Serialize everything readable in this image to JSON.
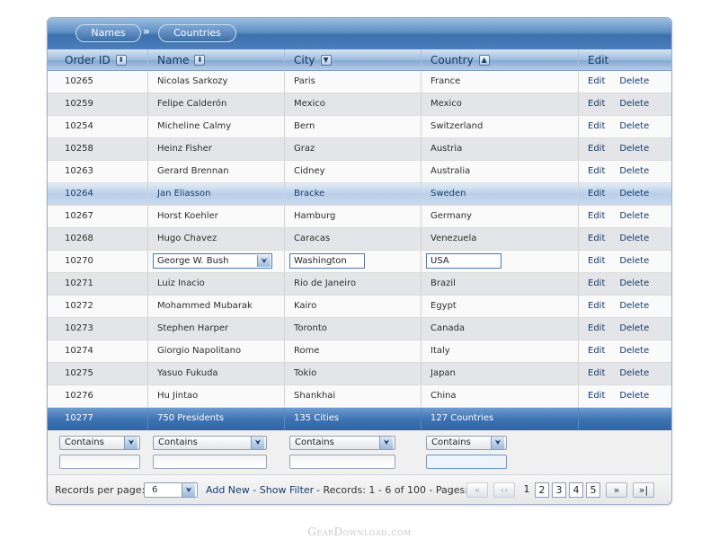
{
  "breadcrumb": {
    "items": [
      "Names",
      "Countries"
    ],
    "separator": "»"
  },
  "columns": [
    {
      "label": "Order ID",
      "sort": "both"
    },
    {
      "label": "Name",
      "sort": "both"
    },
    {
      "label": "City",
      "sort": "desc"
    },
    {
      "label": "Country",
      "sort": "asc"
    },
    {
      "label": "Edit",
      "sort": "none"
    }
  ],
  "rows": [
    {
      "id": "10265",
      "name": "Nicolas Sarkozy",
      "city": "Paris",
      "country": "France"
    },
    {
      "id": "10259",
      "name": "Felipe Calderón",
      "city": "Mexico",
      "country": "Mexico"
    },
    {
      "id": "10254",
      "name": "Micheline Calmy",
      "city": "Bern",
      "country": "Switzerland"
    },
    {
      "id": "10258",
      "name": "Heinz Fisher",
      "city": "Graz",
      "country": "Austria"
    },
    {
      "id": "10263",
      "name": "Gerard Brennan",
      "city": "Cidney",
      "country": "Australia"
    },
    {
      "id": "10264",
      "name": "Jan Eliasson",
      "city": "Bracke",
      "country": "Sweden"
    },
    {
      "id": "10267",
      "name": "Horst Koehler",
      "city": "Hamburg",
      "country": "Germany"
    },
    {
      "id": "10268",
      "name": "Hugo Chavez",
      "city": "Caracas",
      "country": "Venezuela"
    },
    {
      "id": "10270",
      "name": "George W. Bush",
      "city": "Washington",
      "country": "USA"
    },
    {
      "id": "10271",
      "name": "Luiz Inacio",
      "city": "Rio de Janeiro",
      "country": "Brazil"
    },
    {
      "id": "10272",
      "name": "Mohammed Mubarak",
      "city": "Kairo",
      "country": "Egypt"
    },
    {
      "id": "10273",
      "name": "Stephen Harper",
      "city": "Toronto",
      "country": "Canada"
    },
    {
      "id": "10274",
      "name": "Giorgio Napolitano",
      "city": "Rome",
      "country": "Italy"
    },
    {
      "id": "10275",
      "name": "Yasuo Fukuda",
      "city": "Tokio",
      "country": "Japan"
    },
    {
      "id": "10276",
      "name": "Hu Jintao",
      "city": "Shankhai",
      "country": "China"
    }
  ],
  "row_actions": {
    "edit": "Edit",
    "delete": "Delete"
  },
  "selected_row_index": 5,
  "editing_row_index": 8,
  "footer": {
    "id": "10277",
    "name": "750 Presidents",
    "city": "135 Cities",
    "country": "127 Countries"
  },
  "filters": {
    "condition": "Contains",
    "values": [
      "",
      "",
      "",
      ""
    ]
  },
  "pager": {
    "records_per_page_label": "Records per page:",
    "records_per_page_value": "6",
    "add_new": "Add New",
    "separator": " - ",
    "show_filter": "Show Filter",
    "records_text": "- Records: 1 - 6 of 100 - Pages:",
    "first": "«",
    "prev": "‹‹",
    "pages": [
      "1",
      "2",
      "3",
      "4",
      "5"
    ],
    "current_page": "1",
    "next": "»",
    "last": "»|"
  },
  "watermark": "GearDownload.com",
  "colors": {
    "accent": "#3b6fae",
    "header_light": "#c4d7ec",
    "row_alt": "#e4e5e8",
    "link": "#163a6c"
  }
}
